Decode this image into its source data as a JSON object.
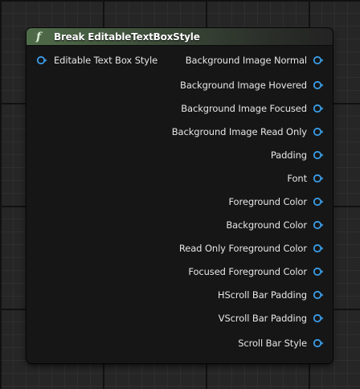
{
  "node": {
    "title": "Break EditableTextBoxStyle",
    "function_icon": "f",
    "header_color": "#4f6c49",
    "pin_color": "#3b9ee8",
    "input_pins": [
      {
        "label": "Editable Text Box Style",
        "icon": "struct-pin-icon"
      }
    ],
    "output_pins": [
      {
        "label": "Background Image Normal",
        "icon": "struct-pin-icon"
      },
      {
        "label": "Background Image Hovered",
        "icon": "struct-pin-icon"
      },
      {
        "label": "Background Image Focused",
        "icon": "struct-pin-icon"
      },
      {
        "label": "Background Image Read Only",
        "icon": "struct-pin-icon"
      },
      {
        "label": "Padding",
        "icon": "struct-pin-icon"
      },
      {
        "label": "Font",
        "icon": "struct-pin-icon"
      },
      {
        "label": "Foreground Color",
        "icon": "struct-pin-icon"
      },
      {
        "label": "Background Color",
        "icon": "struct-pin-icon"
      },
      {
        "label": "Read Only Foreground Color",
        "icon": "struct-pin-icon"
      },
      {
        "label": "Focused Foreground Color",
        "icon": "struct-pin-icon"
      },
      {
        "label": "HScroll Bar Padding",
        "icon": "struct-pin-icon"
      },
      {
        "label": "VScroll Bar Padding",
        "icon": "struct-pin-icon"
      },
      {
        "label": "Scroll Bar Style",
        "icon": "struct-pin-icon"
      }
    ]
  }
}
